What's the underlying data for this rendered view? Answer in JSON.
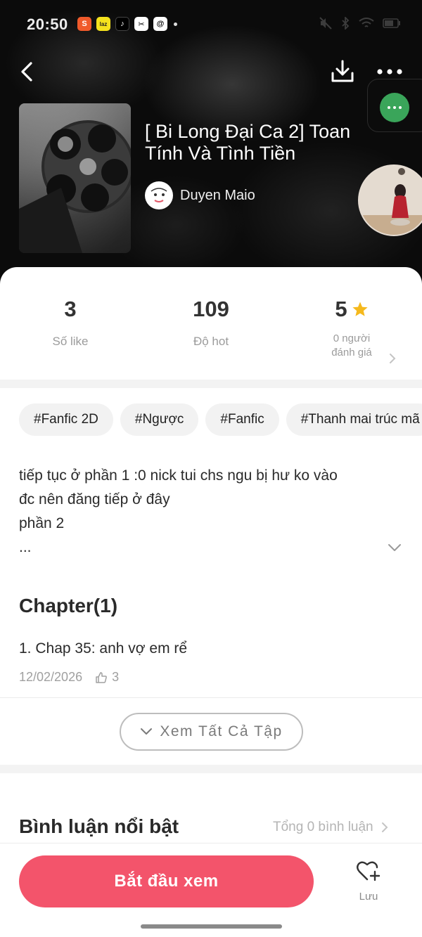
{
  "status_bar": {
    "time": "20:50",
    "apps": [
      {
        "name": "shopee-icon",
        "glyph": "S",
        "bg": "#f05a2b",
        "fg": "#ffffff"
      },
      {
        "name": "lazada-icon",
        "glyph": "L",
        "bg": "#f5e21d",
        "fg": "#222222"
      },
      {
        "name": "tiktok-icon",
        "glyph": "♪",
        "bg": "#000000",
        "fg": "#ffffff"
      },
      {
        "name": "capcut-icon",
        "glyph": "✂",
        "bg": "#ffffff",
        "fg": "#000000"
      },
      {
        "name": "threads-icon",
        "glyph": "@",
        "bg": "#ffffff",
        "fg": "#000000"
      }
    ]
  },
  "nav": {
    "back_icon": "chevron-left-icon",
    "download_icon": "download-icon",
    "more_icon": "more-horizontal-icon"
  },
  "book": {
    "title": "[ Bi Long Đại Ca 2] Toan Tính Và Tình Tiền",
    "author": "Duyen Maio"
  },
  "stats": {
    "likes": {
      "value": "3",
      "label": "Số like"
    },
    "hot": {
      "value": "109",
      "label": "Độ hot"
    },
    "rating": {
      "value": "5",
      "line1": "0 người",
      "line2": "đánh giá"
    }
  },
  "tags": [
    "#Fanfic 2D",
    "#Ngược",
    "#Fanfic",
    "#Thanh mai trúc mã"
  ],
  "description": {
    "line1": "tiếp tục ở phần 1 :0 nick tui chs ngu bị hư ko vào",
    "line2": "đc nên đăng tiếp ở đây",
    "line3": "phần 2",
    "line4": "..."
  },
  "chapters": {
    "heading": "Chapter(1)",
    "items": [
      {
        "title": "1. Chap 35: anh vợ em rể",
        "date": "12/02/2026",
        "likes": "3"
      }
    ],
    "see_all": "Xem Tất Cả Tập"
  },
  "comments": {
    "heading": "Bình luận nổi bật",
    "total": "Tổng 0 bình luận"
  },
  "bottom": {
    "start": "Bắt đầu xem",
    "save": "Lưu"
  },
  "colors": {
    "accent": "#f3546b",
    "star": "#f5b91d",
    "chat_green": "#3aa55a"
  }
}
